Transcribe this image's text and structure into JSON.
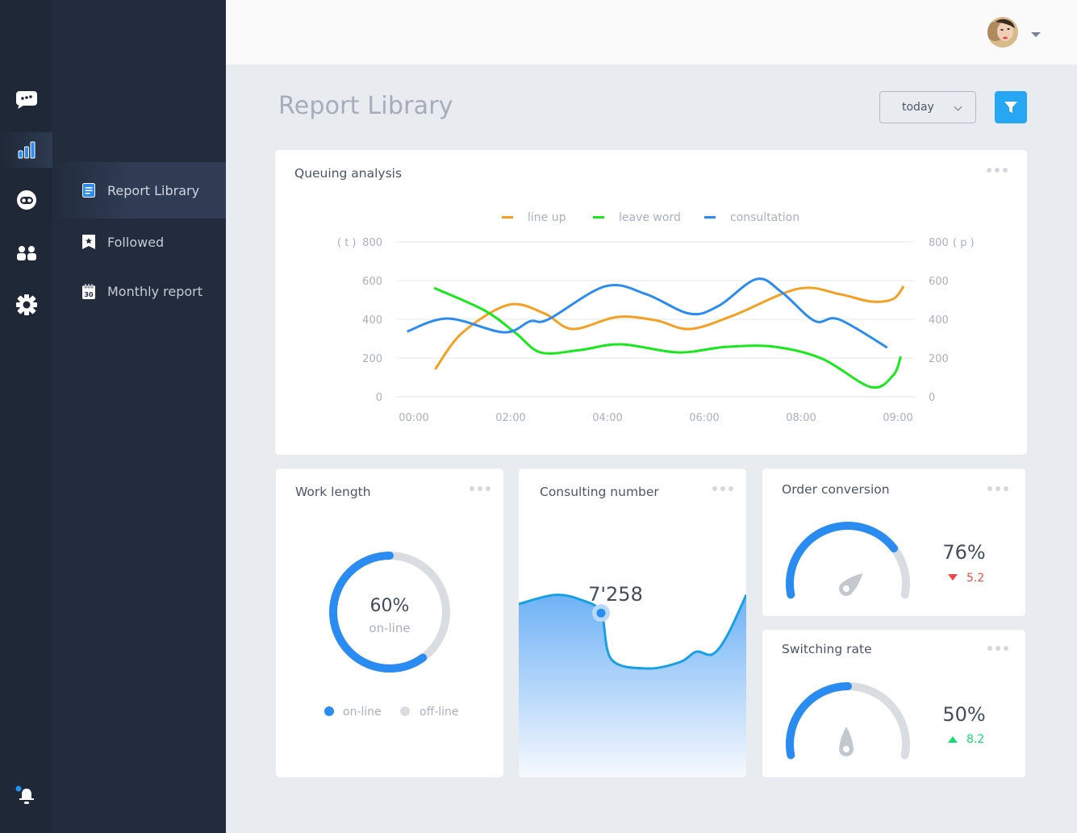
{
  "rail": {
    "items": [
      {
        "name": "chat-icon",
        "active": false
      },
      {
        "name": "bar-chart-icon",
        "active": true
      },
      {
        "name": "robot-icon",
        "active": false
      },
      {
        "name": "users-icon",
        "active": false
      },
      {
        "name": "gear-icon",
        "active": false
      }
    ],
    "bell_has_notification": true
  },
  "subnav": {
    "items": [
      {
        "label": "Report Library",
        "icon": "document-icon",
        "active": true
      },
      {
        "label": "Followed",
        "icon": "bookmark-star-icon",
        "active": false
      },
      {
        "label": "Monthly report",
        "icon": "calendar-icon",
        "calendar_day": "30",
        "active": false
      }
    ]
  },
  "header": {
    "title": "Report Library",
    "date_filter": "today",
    "filter_button": "filter-icon"
  },
  "colors": {
    "accent": "#2a8cf1",
    "line_up": "#f5a022",
    "leave_word": "#19e81c",
    "consultation": "#2a8cf1",
    "down": "#f04848",
    "up": "#10e070",
    "track": "#d9dde2"
  },
  "queuing": {
    "title": "Queuing analysis",
    "left_unit": "( t )",
    "right_unit": "( p )"
  },
  "chart_data": [
    {
      "type": "line",
      "title": "Queuing analysis",
      "x_ticks": [
        "00:00",
        "02:00",
        "04:00",
        "06:00",
        "08:00",
        "09:00"
      ],
      "y_ticks": [
        "0",
        "200",
        "400",
        "600",
        "800"
      ],
      "ylim": [
        0,
        800
      ],
      "ylabel_left": "( t )",
      "ylabel_right": "( p )",
      "legend": "top-center",
      "grid": true,
      "series": [
        {
          "name": "line up",
          "color": "#f5a022",
          "points": [
            [
              0.22,
              142
            ],
            [
              0.5,
              330
            ],
            [
              0.98,
              475
            ],
            [
              1.35,
              430
            ],
            [
              1.64,
              350
            ],
            [
              2.1,
              412
            ],
            [
              2.5,
              395
            ],
            [
              2.85,
              350
            ],
            [
              3.3,
              420
            ],
            [
              3.97,
              558
            ],
            [
              4.4,
              530
            ],
            [
              4.72,
              492
            ],
            [
              4.95,
              505
            ],
            [
              5.06,
              571
            ]
          ]
        },
        {
          "name": "leave word",
          "color": "#19e81c",
          "points": [
            [
              0.21,
              562
            ],
            [
              0.73,
              446
            ],
            [
              1.05,
              330
            ],
            [
              1.31,
              229
            ],
            [
              1.7,
              240
            ],
            [
              2.14,
              271
            ],
            [
              2.73,
              229
            ],
            [
              3.23,
              258
            ],
            [
              3.73,
              258
            ],
            [
              4.22,
              196
            ],
            [
              4.72,
              50
            ],
            [
              4.95,
              110
            ],
            [
              5.03,
              208
            ]
          ]
        },
        {
          "name": "consultation",
          "color": "#2a8cf1",
          "points": [
            [
              -0.07,
              337
            ],
            [
              0.35,
              404
            ],
            [
              0.93,
              333
            ],
            [
              1.2,
              390
            ],
            [
              1.39,
              400
            ],
            [
              1.98,
              571
            ],
            [
              2.4,
              530
            ],
            [
              2.85,
              429
            ],
            [
              3.15,
              470
            ],
            [
              3.54,
              608
            ],
            [
              3.8,
              540
            ],
            [
              4.14,
              392
            ],
            [
              4.39,
              400
            ],
            [
              4.89,
              254
            ]
          ]
        }
      ]
    },
    {
      "type": "pie",
      "title": "Work length",
      "values": [
        60,
        40
      ],
      "labels": [
        "on-line",
        "off-line"
      ],
      "center_value": "60%",
      "center_label": "on-line"
    },
    {
      "type": "area",
      "title": "Consulting number",
      "highlight_label": "7'258",
      "highlight_index": 3,
      "values": [
        65,
        72,
        68,
        58,
        22,
        15,
        20,
        28,
        26,
        40,
        72
      ]
    },
    {
      "type": "gauge",
      "title": "Order conversion",
      "value_pct": 76,
      "value_label": "76%",
      "delta": "5.2",
      "delta_direction": "down"
    },
    {
      "type": "gauge",
      "title": "Switching rate",
      "value_pct": 50,
      "value_label": "50%",
      "delta": "8.2",
      "delta_direction": "up"
    }
  ],
  "cards": {
    "work_length": {
      "title": "Work length",
      "center_value": "60%",
      "center_label": "on-line",
      "legend_online": "on-line",
      "legend_offline": "off-line"
    },
    "consulting": {
      "title": "Consulting number",
      "value": "7'258"
    },
    "order": {
      "title": "Order conversion",
      "value": "76%",
      "delta": "5.2"
    },
    "switching": {
      "title": "Switching rate",
      "value": "50%",
      "delta": "8.2"
    }
  }
}
